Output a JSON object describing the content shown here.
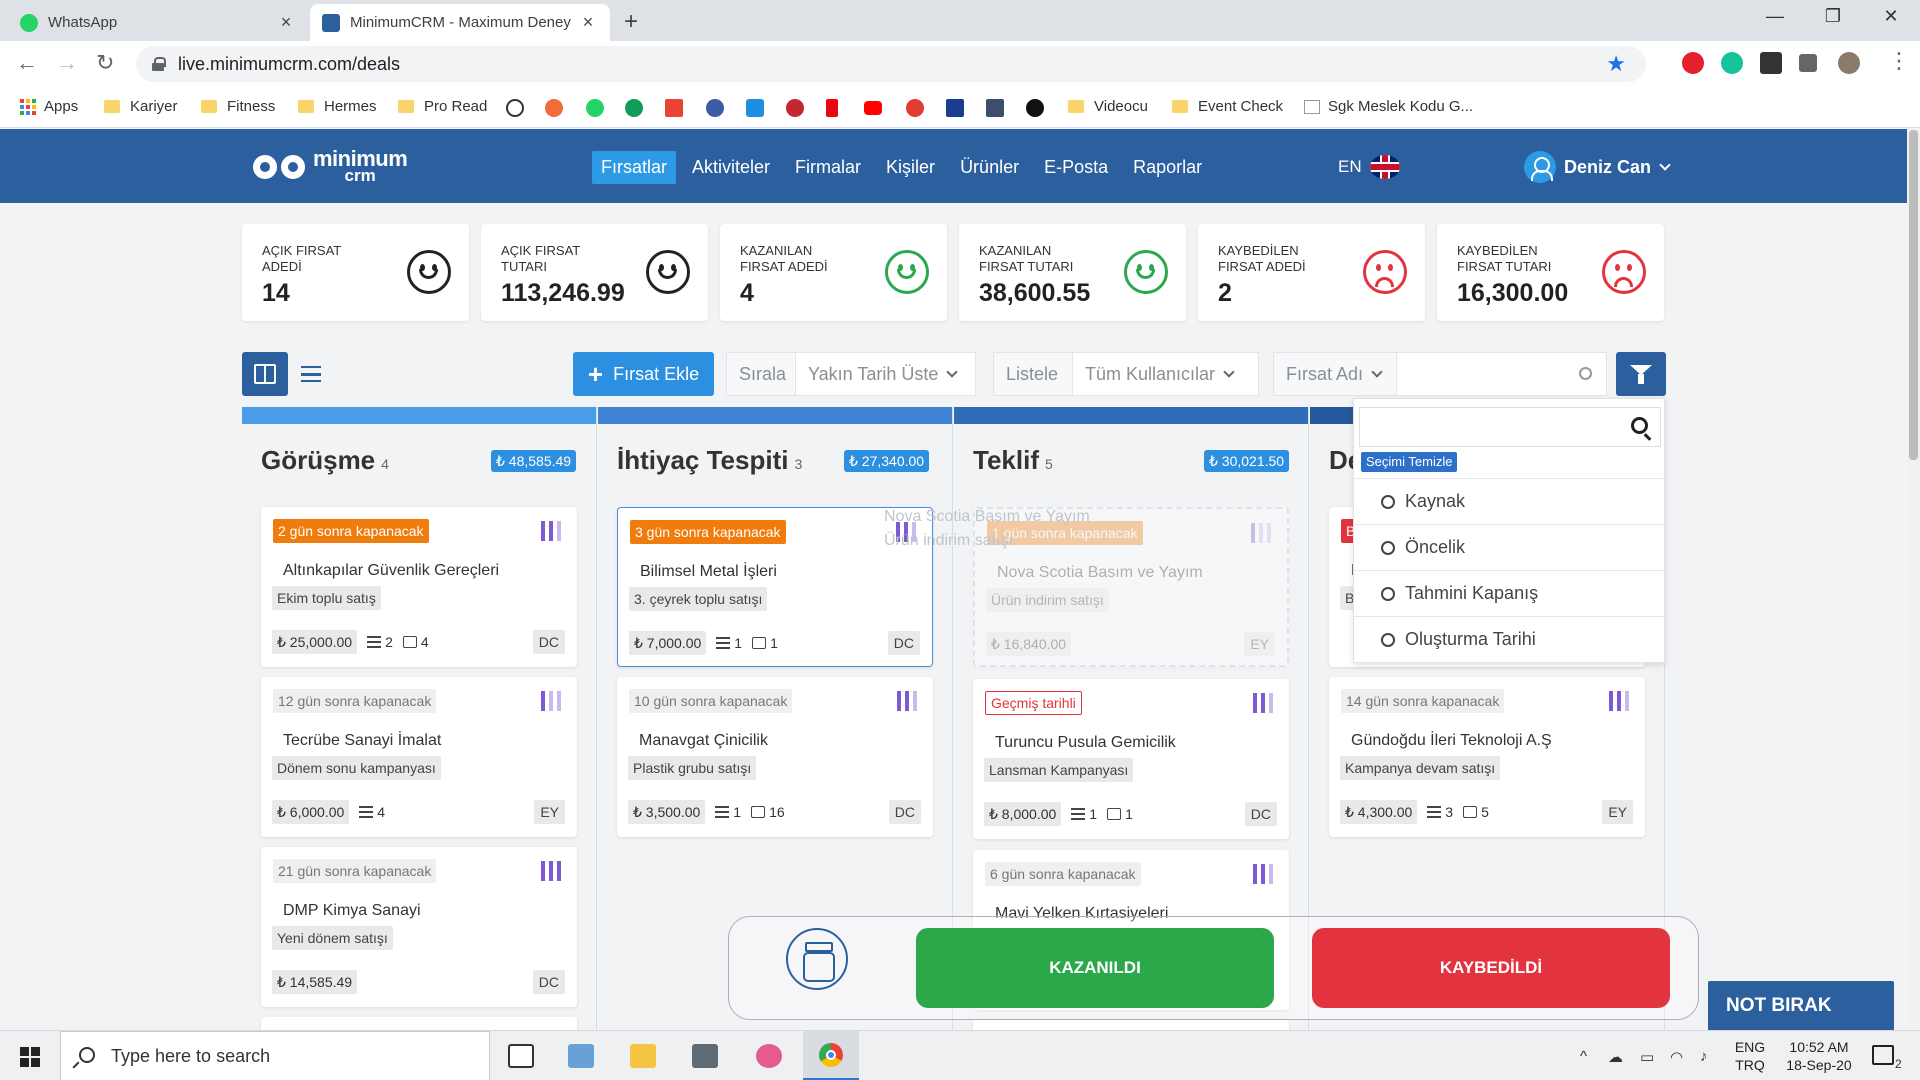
{
  "browser": {
    "tabs": [
      {
        "title": "WhatsApp",
        "active": false
      },
      {
        "title": "MinimumCRM - Maximum Deney",
        "active": true
      }
    ],
    "url": "live.minimumcrm.com/deals",
    "bookmarks": [
      "Apps",
      "Kariyer",
      "Fitness",
      "Hermes",
      "Pro Read",
      "Videocu",
      "Event Check",
      "Sgk Meslek Kodu G..."
    ]
  },
  "app": {
    "logo_top": "minimum",
    "logo_bottom": "crm",
    "nav": [
      "Fırsatlar",
      "Aktiviteler",
      "Firmalar",
      "Kişiler",
      "Ürünler",
      "E-Posta",
      "Raporlar"
    ],
    "nav_active": "Fırsatlar",
    "lang": "EN",
    "user": "Deniz Can"
  },
  "stats": [
    {
      "label": "AÇIK FIRSAT ADEDİ",
      "value": "14",
      "mood": "neutral"
    },
    {
      "label": "AÇIK FIRSAT TUTARI",
      "value": "113,246.99",
      "mood": "neutral"
    },
    {
      "label": "KAZANILAN FIRSAT ADEDİ",
      "value": "4",
      "mood": "happy"
    },
    {
      "label": "KAZANILAN FIRSAT TUTARI",
      "value": "38,600.55",
      "mood": "happy"
    },
    {
      "label": "KAYBEDİLEN FIRSAT ADEDİ",
      "value": "2",
      "mood": "sad"
    },
    {
      "label": "KAYBEDİLEN FIRSAT TUTARI",
      "value": "16,300.00",
      "mood": "sad"
    }
  ],
  "filters": {
    "add_label": "Fırsat Ekle",
    "sort_label": "Sırala",
    "sort_value": "Yakın Tarih Üste",
    "list_label": "Listele",
    "list_value": "Tüm Kullanıcılar",
    "field_value": "Fırsat Adı",
    "search_placeholder": ""
  },
  "columns": [
    {
      "title": "Görüşme",
      "count": "4",
      "total": "₺ 48,585.49",
      "cards": [
        {
          "badge": "2 gün sonra kapanacak",
          "badge_style": "orange",
          "prio": 2,
          "name": "Altınkapılar Güvenlik Gereçleri",
          "tag": "Ekim toplu satış",
          "amount": "₺ 25,000.00",
          "tasks": "2",
          "notes": "4",
          "owner": "DC"
        },
        {
          "badge": "12 gün sonra kapanacak",
          "badge_style": "gray",
          "prio": 1,
          "name": "Tecrübe Sanayi İmalat",
          "tag": "Dönem sonu kampanyası",
          "amount": "₺ 6,000.00",
          "tasks": "4",
          "notes": "",
          "owner": "EY"
        },
        {
          "badge": "21 gün sonra kapanacak",
          "badge_style": "gray",
          "prio": 3,
          "name": "DMP Kimya Sanayi",
          "tag": "Yeni dönem satışı",
          "amount": "₺ 14,585.49",
          "tasks": "",
          "notes": "",
          "owner": "DC"
        }
      ]
    },
    {
      "title": "İhtiyaç Tespiti",
      "count": "3",
      "total": "₺ 27,340.00",
      "cards": [
        {
          "badge": "3 gün sonra kapanacak",
          "badge_style": "orange",
          "prio": 2,
          "name": "Bilimsel Metal İşleri",
          "tag": "3. çeyrek toplu satışı",
          "amount": "₺ 7,000.00",
          "tasks": "1",
          "notes": "1",
          "owner": "DC"
        },
        {
          "badge": "10 gün sonra kapanacak",
          "badge_style": "gray",
          "prio": 2,
          "name": "Manavgat Çinicilik",
          "tag": "Plastik grubu satışı",
          "amount": "₺ 3,500.00",
          "tasks": "1",
          "notes": "16",
          "owner": "DC"
        }
      ]
    },
    {
      "title": "Teklif",
      "count": "5",
      "total": "₺ 30,021.50",
      "cards": [
        {
          "badge": "1 gün sonra kapanacak",
          "badge_style": "orange",
          "prio": 1,
          "name": "Nova Scotia Basım ve Yayım",
          "tag": "Ürün indirim satışı",
          "amount": "₺ 16,840.00",
          "tasks": "",
          "notes": "",
          "owner": "EY"
        },
        {
          "badge": "Geçmiş tarihli",
          "badge_style": "red",
          "prio": 2,
          "name": "Turuncu Pusula Gemicilik",
          "tag": "Lansman Kampanyası",
          "amount": "₺ 8,000.00",
          "tasks": "1",
          "notes": "1",
          "owner": "DC"
        },
        {
          "badge": "6 gün sonra kapanacak",
          "badge_style": "gray",
          "prio": 2,
          "name": "Mavi Yelken Kırtasiyeleri",
          "tag": "",
          "amount": "",
          "tasks": "",
          "notes": "",
          "owner": ""
        }
      ]
    },
    {
      "title": "De",
      "count": "",
      "total": "",
      "cards": [
        {
          "badge": "B",
          "badge_style": "red",
          "prio": 0,
          "name": "Ko",
          "tag": "B",
          "amount": "",
          "tasks": "",
          "notes": "",
          "owner": ""
        },
        {
          "badge": "14 gün sonra kapanacak",
          "badge_style": "gray",
          "prio": 2,
          "name": "Gündoğdu İleri Teknoloji A.Ş",
          "tag": "Kampanya devam satışı",
          "amount": "₺ 4,300.00",
          "tasks": "3",
          "notes": "5",
          "owner": "EY"
        }
      ]
    }
  ],
  "sort_dropdown": {
    "clear_label": "Seçimi Temizle",
    "options": [
      "Kaynak",
      "Öncelik",
      "Tahmini Kapanış",
      "Oluşturma Tarihi"
    ]
  },
  "drop_targets": {
    "won": "KAZANILDI",
    "lost": "KAYBEDİLDİ",
    "note": "NOT BIRAK"
  },
  "taskbar": {
    "search_placeholder": "Type here to search",
    "lang_top": "ENG",
    "lang_bottom": "TRQ",
    "time": "10:52 AM",
    "date": "18-Sep-20",
    "notifications": "2"
  },
  "colors": {
    "header": "#2c5f9e",
    "accent": "#2d8fe0",
    "won": "#2aa84a",
    "lost": "#e2333f",
    "overdue": "#f07c0d",
    "priority": "#7e5bd2"
  }
}
